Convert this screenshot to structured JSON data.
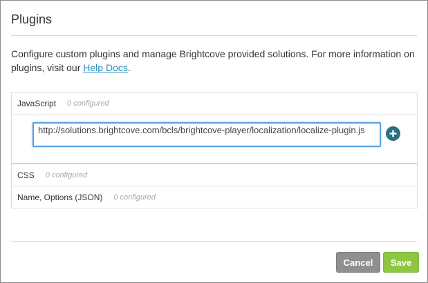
{
  "dialog": {
    "title": "Plugins",
    "intro_text": "Configure custom plugins and manage Brightcove provided solutions. For more information on plugins, visit our ",
    "help_link_label": "Help Docs",
    "intro_suffix": "."
  },
  "sections": {
    "javascript": {
      "label": "JavaScript",
      "count": "0 configured",
      "input_value": "http://solutions.brightcove.com/bcls/brightcove-player/localization/localize-plugin.js"
    },
    "css": {
      "label": "CSS",
      "count": "0 configured"
    },
    "json": {
      "label": "Name, Options (JSON)",
      "count": "0 configured"
    }
  },
  "footer": {
    "cancel_label": "Cancel",
    "save_label": "Save"
  },
  "colors": {
    "link": "#2a8cc2",
    "add_button": "#2a6f82",
    "save_button": "#8dc63f",
    "cancel_button": "#8f8f8f",
    "input_focus": "#5a9fe0"
  },
  "icons": {
    "add": "plus-circle-icon"
  }
}
